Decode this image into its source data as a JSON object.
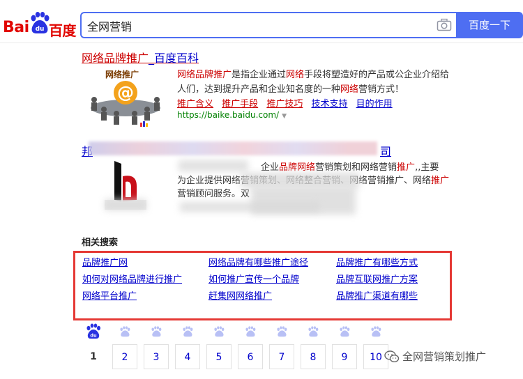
{
  "header": {
    "logo_bai": "Bai",
    "logo_du": "du",
    "logo_cn": "百度",
    "search_value": "全网营销",
    "search_button": "百度一下"
  },
  "result1": {
    "title_red": "网络品牌推广",
    "title_plain": "_百度百科",
    "image_caption": "网络推广",
    "desc_parts": [
      "网络品牌推广",
      "是指企业通过",
      "网络",
      "手段将塑造好的产品或公企业介绍给人们，达到提升产品和企业知名度的一种",
      "网络",
      "营销方式！"
    ],
    "links": [
      "推广含义",
      "推广手段",
      "推广技巧",
      "技术支持",
      "目的作用"
    ],
    "url": "https://baike.baidu.com/"
  },
  "result2": {
    "title_start": "邦",
    "title_end": "司",
    "desc_line1_a": "企业",
    "desc_line1_hl": "品牌网络",
    "desc_line1_b": "营销策划和网络营销",
    "desc_line1_hl2": "推广",
    "desc_line1_c": ",,主要",
    "desc_line2": "为企业提供网络营销策划、网络整合营销、网络营销推广、网络",
    "desc_line2_hl": "推广",
    "desc_line3": "营销顾问服务。双"
  },
  "related": {
    "title": "相关搜索",
    "items": [
      [
        "品牌推广网",
        "网络品牌有哪些推广途径",
        "品牌推广有哪些方式"
      ],
      [
        "如何对网络品牌进行推广",
        "如何推广宣传一个品牌",
        "品牌互联网推广方案"
      ],
      [
        "网络平台推广",
        "赶集网网络推广",
        "品牌推广渠道有哪些"
      ]
    ]
  },
  "pagination": {
    "current": "1",
    "pages": [
      "2",
      "3",
      "4",
      "5",
      "6",
      "7",
      "8",
      "9",
      "10"
    ]
  },
  "watermark": {
    "text": "全网营销策划推广"
  },
  "colors": {
    "brand_blue": "#4e6ef2",
    "link_blue": "#0000cc",
    "highlight_red": "#cc0000",
    "url_green": "#008000",
    "frame_red": "#e53935"
  }
}
